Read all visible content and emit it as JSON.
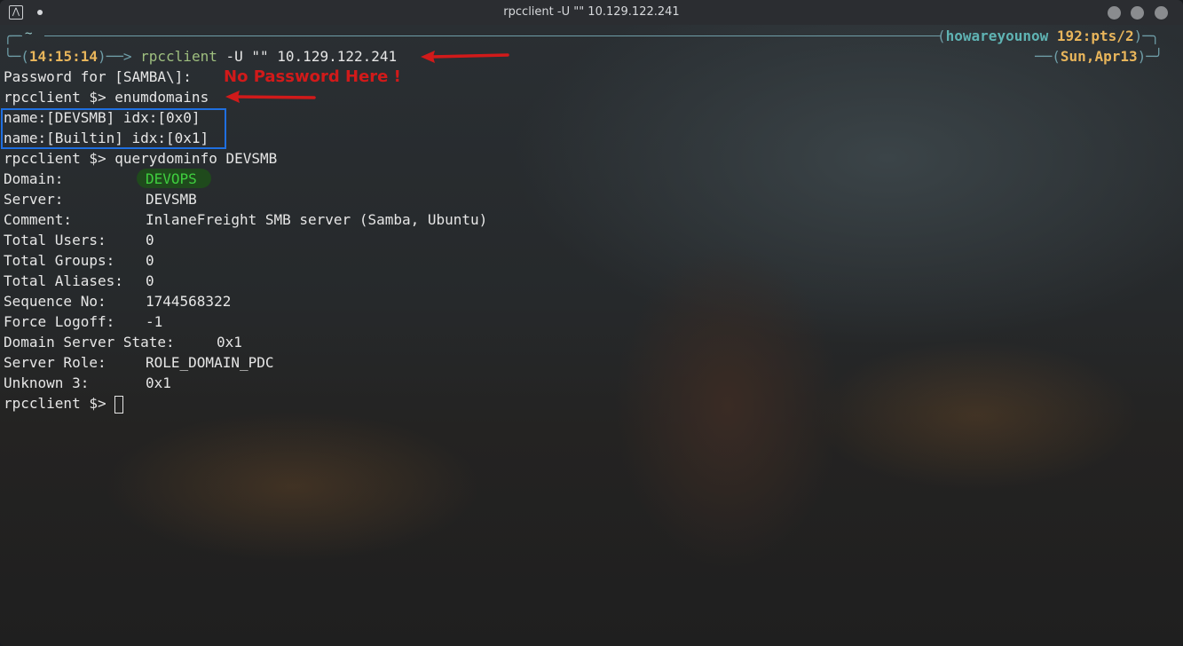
{
  "window": {
    "title": "rpcclient -U \"\" 10.129.122.241"
  },
  "prompt": {
    "tilde": "~",
    "time": "14:15:14",
    "command": "rpcclient",
    "args": "-U \"\" 10.129.122.241",
    "user": "howareyounow",
    "tty": "192:pts/2",
    "date": "Sun,Apr13"
  },
  "annotations": {
    "no_password": "No Password Here !"
  },
  "terminal": {
    "password_line": "Password for [SAMBA\\]:",
    "rpc_prompt": "rpcclient $>",
    "cmd_enumdomains": "enumdomains",
    "domains": [
      "name:[DEVSMB] idx:[0x0]",
      "name:[Builtin] idx:[0x1]"
    ],
    "cmd_querydominfo": "querydominfo DEVSMB",
    "info": [
      {
        "label": "Domain:",
        "value": "DEVOPS"
      },
      {
        "label": "Server:",
        "value": "DEVSMB"
      },
      {
        "label": "Comment:",
        "value": "InlaneFreight SMB server (Samba, Ubuntu)"
      },
      {
        "label": "Total Users:",
        "value": "0"
      },
      {
        "label": "Total Groups:",
        "value": "0"
      },
      {
        "label": "Total Aliases:",
        "value": "0"
      },
      {
        "label": "Sequence No:",
        "value": "1744568322"
      },
      {
        "label": "Force Logoff:",
        "value": "-1"
      },
      {
        "label": "Domain Server State:",
        "value": "0x1"
      },
      {
        "label": "Server Role:",
        "value": "ROLE_DOMAIN_PDC"
      },
      {
        "label": "Unknown 3:",
        "value": "0x1"
      }
    ]
  },
  "colors": {
    "accent_red": "#d11a1a",
    "box_blue": "#1f6fe0",
    "prompt_time": "#e8b55b",
    "prompt_user": "#5fb3b3"
  }
}
